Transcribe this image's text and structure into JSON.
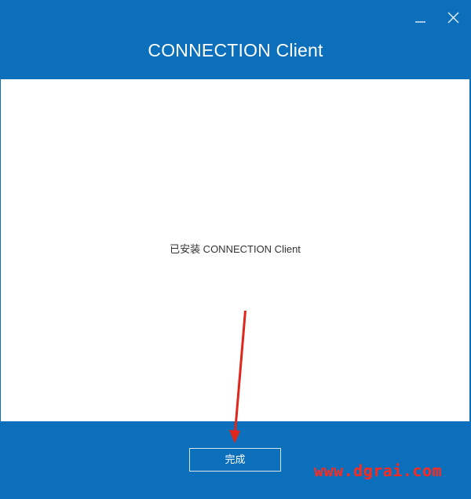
{
  "window": {
    "title": "CONNECTION Client",
    "controls": {
      "minimize_icon": "minimize-icon",
      "close_icon": "close-icon"
    }
  },
  "content": {
    "status_text": "已安装 CONNECTION Client"
  },
  "footer": {
    "finish_label": "完成"
  },
  "annotation": {
    "arrow_color": "#e0251b",
    "watermark": "www.dgrai.com"
  },
  "colors": {
    "brand_blue": "#0b6fbb",
    "content_bg": "#ffffff",
    "text": "#333333"
  }
}
